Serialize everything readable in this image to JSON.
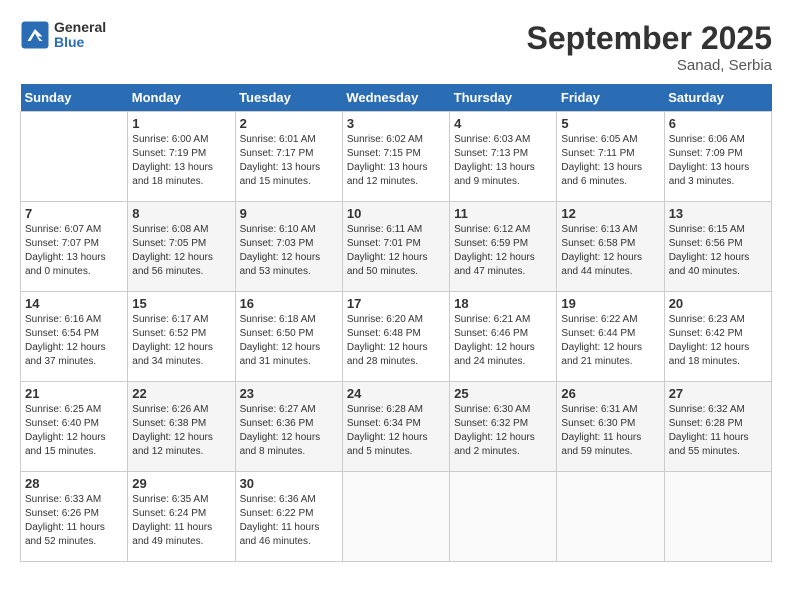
{
  "header": {
    "logo_general": "General",
    "logo_blue": "Blue",
    "title": "September 2025",
    "subtitle": "Sanad, Serbia"
  },
  "calendar": {
    "days_of_week": [
      "Sunday",
      "Monday",
      "Tuesday",
      "Wednesday",
      "Thursday",
      "Friday",
      "Saturday"
    ],
    "weeks": [
      [
        {
          "day": "",
          "info": ""
        },
        {
          "day": "1",
          "info": "Sunrise: 6:00 AM\nSunset: 7:19 PM\nDaylight: 13 hours\nand 18 minutes."
        },
        {
          "day": "2",
          "info": "Sunrise: 6:01 AM\nSunset: 7:17 PM\nDaylight: 13 hours\nand 15 minutes."
        },
        {
          "day": "3",
          "info": "Sunrise: 6:02 AM\nSunset: 7:15 PM\nDaylight: 13 hours\nand 12 minutes."
        },
        {
          "day": "4",
          "info": "Sunrise: 6:03 AM\nSunset: 7:13 PM\nDaylight: 13 hours\nand 9 minutes."
        },
        {
          "day": "5",
          "info": "Sunrise: 6:05 AM\nSunset: 7:11 PM\nDaylight: 13 hours\nand 6 minutes."
        },
        {
          "day": "6",
          "info": "Sunrise: 6:06 AM\nSunset: 7:09 PM\nDaylight: 13 hours\nand 3 minutes."
        }
      ],
      [
        {
          "day": "7",
          "info": "Sunrise: 6:07 AM\nSunset: 7:07 PM\nDaylight: 13 hours\nand 0 minutes."
        },
        {
          "day": "8",
          "info": "Sunrise: 6:08 AM\nSunset: 7:05 PM\nDaylight: 12 hours\nand 56 minutes."
        },
        {
          "day": "9",
          "info": "Sunrise: 6:10 AM\nSunset: 7:03 PM\nDaylight: 12 hours\nand 53 minutes."
        },
        {
          "day": "10",
          "info": "Sunrise: 6:11 AM\nSunset: 7:01 PM\nDaylight: 12 hours\nand 50 minutes."
        },
        {
          "day": "11",
          "info": "Sunrise: 6:12 AM\nSunset: 6:59 PM\nDaylight: 12 hours\nand 47 minutes."
        },
        {
          "day": "12",
          "info": "Sunrise: 6:13 AM\nSunset: 6:58 PM\nDaylight: 12 hours\nand 44 minutes."
        },
        {
          "day": "13",
          "info": "Sunrise: 6:15 AM\nSunset: 6:56 PM\nDaylight: 12 hours\nand 40 minutes."
        }
      ],
      [
        {
          "day": "14",
          "info": "Sunrise: 6:16 AM\nSunset: 6:54 PM\nDaylight: 12 hours\nand 37 minutes."
        },
        {
          "day": "15",
          "info": "Sunrise: 6:17 AM\nSunset: 6:52 PM\nDaylight: 12 hours\nand 34 minutes."
        },
        {
          "day": "16",
          "info": "Sunrise: 6:18 AM\nSunset: 6:50 PM\nDaylight: 12 hours\nand 31 minutes."
        },
        {
          "day": "17",
          "info": "Sunrise: 6:20 AM\nSunset: 6:48 PM\nDaylight: 12 hours\nand 28 minutes."
        },
        {
          "day": "18",
          "info": "Sunrise: 6:21 AM\nSunset: 6:46 PM\nDaylight: 12 hours\nand 24 minutes."
        },
        {
          "day": "19",
          "info": "Sunrise: 6:22 AM\nSunset: 6:44 PM\nDaylight: 12 hours\nand 21 minutes."
        },
        {
          "day": "20",
          "info": "Sunrise: 6:23 AM\nSunset: 6:42 PM\nDaylight: 12 hours\nand 18 minutes."
        }
      ],
      [
        {
          "day": "21",
          "info": "Sunrise: 6:25 AM\nSunset: 6:40 PM\nDaylight: 12 hours\nand 15 minutes."
        },
        {
          "day": "22",
          "info": "Sunrise: 6:26 AM\nSunset: 6:38 PM\nDaylight: 12 hours\nand 12 minutes."
        },
        {
          "day": "23",
          "info": "Sunrise: 6:27 AM\nSunset: 6:36 PM\nDaylight: 12 hours\nand 8 minutes."
        },
        {
          "day": "24",
          "info": "Sunrise: 6:28 AM\nSunset: 6:34 PM\nDaylight: 12 hours\nand 5 minutes."
        },
        {
          "day": "25",
          "info": "Sunrise: 6:30 AM\nSunset: 6:32 PM\nDaylight: 12 hours\nand 2 minutes."
        },
        {
          "day": "26",
          "info": "Sunrise: 6:31 AM\nSunset: 6:30 PM\nDaylight: 11 hours\nand 59 minutes."
        },
        {
          "day": "27",
          "info": "Sunrise: 6:32 AM\nSunset: 6:28 PM\nDaylight: 11 hours\nand 55 minutes."
        }
      ],
      [
        {
          "day": "28",
          "info": "Sunrise: 6:33 AM\nSunset: 6:26 PM\nDaylight: 11 hours\nand 52 minutes."
        },
        {
          "day": "29",
          "info": "Sunrise: 6:35 AM\nSunset: 6:24 PM\nDaylight: 11 hours\nand 49 minutes."
        },
        {
          "day": "30",
          "info": "Sunrise: 6:36 AM\nSunset: 6:22 PM\nDaylight: 11 hours\nand 46 minutes."
        },
        {
          "day": "",
          "info": ""
        },
        {
          "day": "",
          "info": ""
        },
        {
          "day": "",
          "info": ""
        },
        {
          "day": "",
          "info": ""
        }
      ]
    ]
  }
}
